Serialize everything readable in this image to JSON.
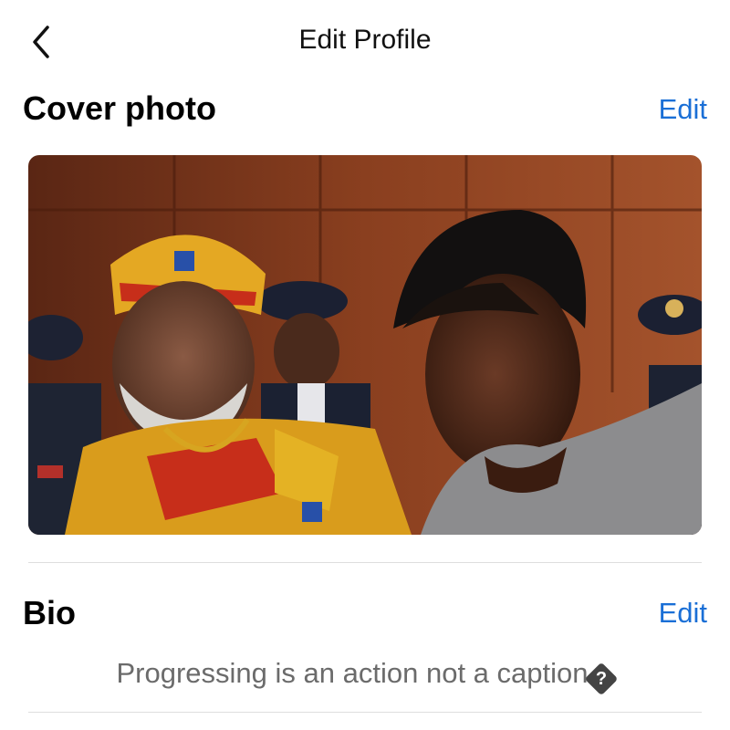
{
  "header": {
    "title": "Edit Profile",
    "back_icon": "chevron-left-icon"
  },
  "cover_photo_section": {
    "heading": "Cover photo",
    "edit_label": "Edit",
    "image": {
      "subject": "cover photo"
    }
  },
  "bio_section": {
    "heading": "Bio",
    "edit_label": "Edit",
    "bio_text": "Progressing is an action not a caption",
    "trailing_glyph": "?"
  },
  "colors": {
    "accent": "#1a6fd6",
    "bio_text": "#6b6b6b",
    "divider": "#dedede"
  }
}
